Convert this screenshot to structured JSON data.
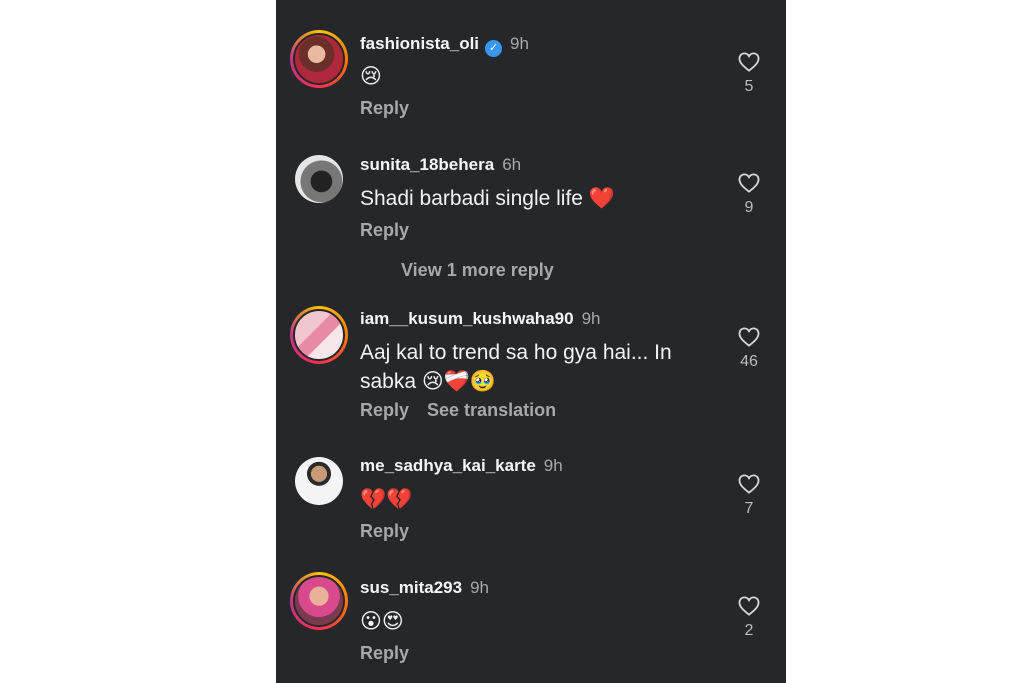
{
  "comments": [
    {
      "username": "fashionista_oli",
      "verified": true,
      "time": "9h",
      "text": "😢",
      "actions": [
        "Reply"
      ],
      "likes": "5",
      "avatar": "story"
    },
    {
      "username": "sunita_18behera",
      "verified": false,
      "time": "6h",
      "text": "Shadi barbadi single life ❤️",
      "actions": [
        "Reply"
      ],
      "likes": "9",
      "avatar": "plain"
    },
    {
      "username": "iam__kusum_kushwaha90",
      "verified": false,
      "time": "9h",
      "text": "Aaj kal to trend sa ho gya hai... In sabka 😢❤️‍🩹🥹",
      "actions": [
        "Reply",
        "See translation"
      ],
      "likes": "46",
      "avatar": "story"
    },
    {
      "username": "me_sadhya_kai_karte",
      "verified": false,
      "time": "9h",
      "text": "💔💔",
      "actions": [
        "Reply"
      ],
      "likes": "7",
      "avatar": "plain"
    },
    {
      "username": "sus_mita293",
      "verified": false,
      "time": "9h",
      "text": "😮😍",
      "actions": [
        "Reply"
      ],
      "likes": "2",
      "avatar": "story"
    }
  ],
  "view_more_replies": "View 1 more reply",
  "icons": {
    "like": "heart-outline-icon",
    "verified": "verified-badge-icon"
  },
  "colors": {
    "background": "#26272b",
    "secondary_text": "#a8a8a8",
    "verified": "#3897f0"
  }
}
